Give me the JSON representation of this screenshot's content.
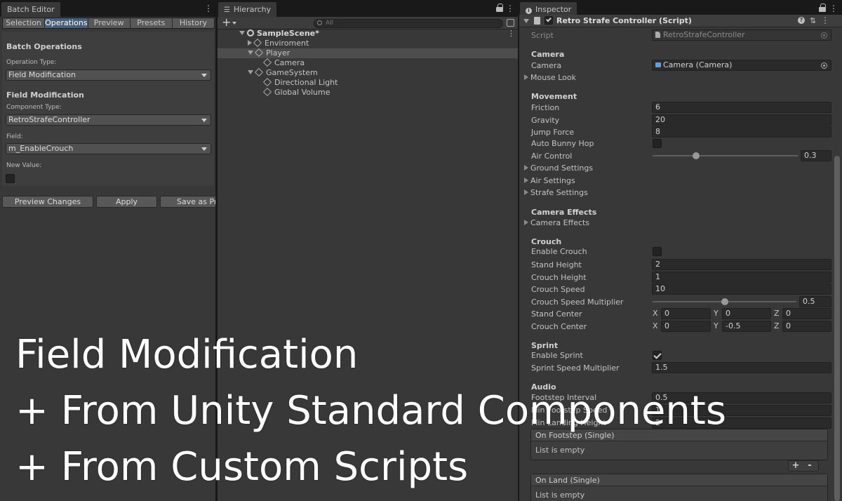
{
  "batch_editor": {
    "tab_title": "Batch Editor",
    "tabs": [
      {
        "label": "Selection",
        "active": false
      },
      {
        "label": "Operations",
        "active": true
      },
      {
        "label": "Preview",
        "active": false
      },
      {
        "label": "Presets",
        "active": false
      },
      {
        "label": "History",
        "active": false
      }
    ],
    "section_title": "Batch Operations",
    "operation_type_label": "Operation Type:",
    "operation_type_value": "Field Modification",
    "field_mod_title": "Field Modification",
    "component_type_label": "Component Type:",
    "component_type_value": "RetroStrafeController",
    "field_label": "Field:",
    "field_value": "m_EnableCrouch",
    "new_value_label": "New Value:",
    "buttons": {
      "preview": "Preview Changes",
      "apply": "Apply",
      "save_preset": "Save as Preset"
    }
  },
  "hierarchy": {
    "tab_title": "Hierarchy",
    "search_placeholder": "All",
    "items": [
      {
        "label": "SampleScene*",
        "depth": 0,
        "expanded": true
      },
      {
        "label": "Enviroment",
        "depth": 1,
        "expanded": false
      },
      {
        "label": "Player",
        "depth": 1,
        "expanded": true,
        "selected": true
      },
      {
        "label": "Camera",
        "depth": 2
      },
      {
        "label": "GameSystem",
        "depth": 1,
        "expanded": true
      },
      {
        "label": "Directional Light",
        "depth": 2
      },
      {
        "label": "Global Volume",
        "depth": 2
      }
    ]
  },
  "inspector": {
    "tab_title": "Inspector",
    "component_title": "Retro Strafe Controller (Script)",
    "script_label": "Script",
    "script_value": "RetroStrafeController",
    "camera_header": "Camera",
    "camera_label": "Camera",
    "camera_value": "Camera (Camera)",
    "mouse_look": "Mouse Look",
    "movement_header": "Movement",
    "friction_label": "Friction",
    "friction_value": "6",
    "gravity_label": "Gravity",
    "gravity_value": "20",
    "jump_label": "Jump Force",
    "jump_value": "8",
    "bunny_label": "Auto Bunny Hop",
    "air_control_label": "Air Control",
    "air_control_value": "0.3",
    "air_control_fraction": 0.3,
    "ground_settings": "Ground Settings",
    "air_settings": "Air Settings",
    "strafe_settings": "Strafe Settings",
    "camfx_header": "Camera Effects",
    "camfx_fold": "Camera Effects",
    "crouch_header": "Crouch",
    "enable_crouch_label": "Enable Crouch",
    "stand_height_label": "Stand Height",
    "stand_height_value": "2",
    "crouch_height_label": "Crouch Height",
    "crouch_height_value": "1",
    "crouch_speed_label": "Crouch Speed",
    "crouch_speed_value": "10",
    "crouch_mult_label": "Crouch Speed Multiplier",
    "crouch_mult_value": "0.5",
    "crouch_mult_fraction": 0.5,
    "stand_center_label": "Stand Center",
    "stand_center": {
      "x": "0",
      "y": "0",
      "z": "0"
    },
    "crouch_center_label": "Crouch Center",
    "crouch_center": {
      "x": "0",
      "y": "-0.5",
      "z": "0"
    },
    "axis": {
      "x": "X",
      "y": "Y",
      "z": "Z"
    },
    "sprint_header": "Sprint",
    "enable_sprint_label": "Enable Sprint",
    "sprint_mult_label": "Sprint Speed Multiplier",
    "sprint_mult_value": "1.5",
    "audio_header": "Audio",
    "footstep_interval_label": "Footstep Interval",
    "footstep_interval_value": "0.5",
    "min_footstep_label": "Min Footstep Speed",
    "min_footstep_value": "1",
    "min_landing_label": "Min Landing Height",
    "min_landing_value": "2",
    "on_footstep_title": "On Footstep (Single)",
    "on_land_title": "On Land (Single)",
    "list_empty": "List is empty",
    "plus": "+",
    "minus": "-"
  },
  "overlay": {
    "line1": "Field Modification",
    "line2": "+ From Unity Standard Components",
    "line3": "+ From Custom Scripts"
  }
}
